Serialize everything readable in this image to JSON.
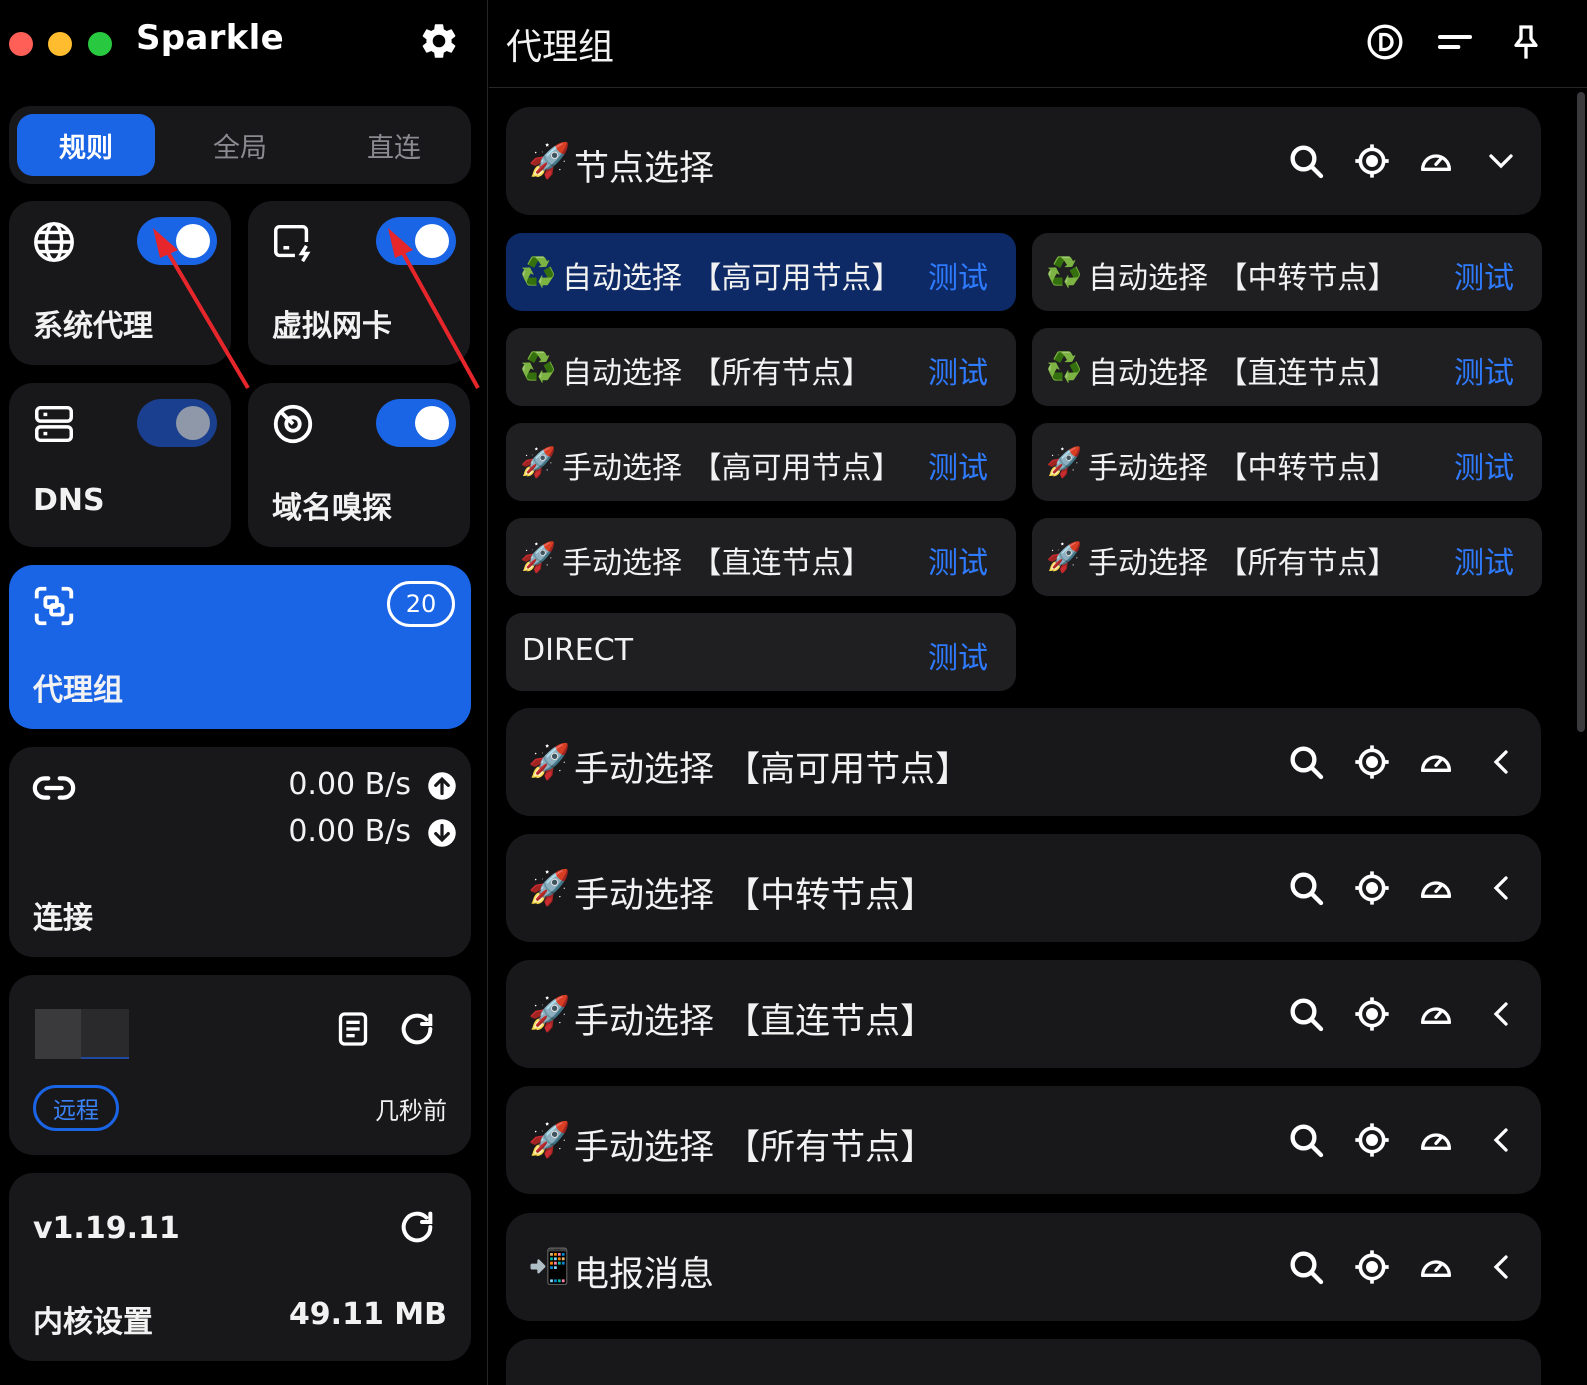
{
  "app": {
    "name": "Sparkle"
  },
  "modes": [
    "规则",
    "全局",
    "直连"
  ],
  "cards": {
    "system_proxy": "系统代理",
    "tun": "虚拟网卡",
    "dns": "DNS",
    "sniff": "域名嗅探",
    "proxy_groups": "代理组",
    "proxy_groups_count": "20",
    "connections": "连接",
    "upload_rate": "0.00 B/s",
    "download_rate": "0.00 B/s",
    "profile_type": "远程",
    "profile_updated": "几秒前",
    "core_version": "v1.19.11",
    "core_settings": "内核设置",
    "memory": "49.11 MB"
  },
  "toggles": {
    "system_proxy": true,
    "tun": true,
    "dns": true,
    "sniff": true
  },
  "main": {
    "title": "代理组"
  },
  "expanded_group": {
    "name": "节点选择",
    "emoji": "🚀",
    "proxies": [
      {
        "emoji": "♻️",
        "name": "自动选择 【高可用节点】",
        "test": "测试",
        "selected": true
      },
      {
        "emoji": "♻️",
        "name": "自动选择 【中转节点】",
        "test": "测试"
      },
      {
        "emoji": "♻️",
        "name": "自动选择 【所有节点】",
        "test": "测试"
      },
      {
        "emoji": "♻️",
        "name": "自动选择 【直连节点】",
        "test": "测试"
      },
      {
        "emoji": "🚀",
        "name": "手动选择 【高可用节点】",
        "test": "测试"
      },
      {
        "emoji": "🚀",
        "name": "手动选择 【中转节点】",
        "test": "测试"
      },
      {
        "emoji": "🚀",
        "name": "手动选择 【直连节点】",
        "test": "测试"
      },
      {
        "emoji": "🚀",
        "name": "手动选择 【所有节点】",
        "test": "测试"
      },
      {
        "emoji": "",
        "name": "DIRECT",
        "test": "测试"
      }
    ]
  },
  "groups": [
    {
      "emoji": "🚀",
      "name": "手动选择 【高可用节点】"
    },
    {
      "emoji": "🚀",
      "name": "手动选择 【中转节点】"
    },
    {
      "emoji": "🚀",
      "name": "手动选择 【直连节点】"
    },
    {
      "emoji": "🚀",
      "name": "手动选择 【所有节点】"
    },
    {
      "emoji": "📲",
      "name": "电报消息"
    }
  ],
  "colors": {
    "accent": "#1a64e6",
    "link": "#2f7bff",
    "card": "#18181b",
    "selected": "#0d2a66"
  }
}
